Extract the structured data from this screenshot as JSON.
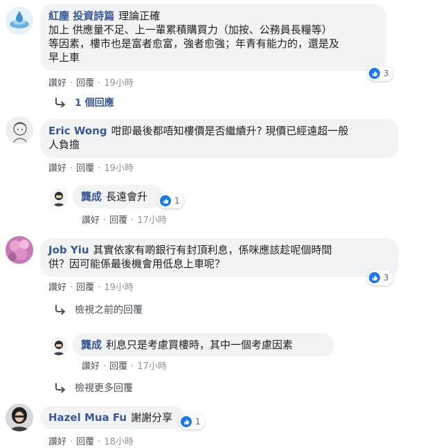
{
  "comments": [
    {
      "author": "紅塵 投資詩篇",
      "lines": [
        "理論正確",
        "加上 供應量不足、上一輩累積購買力（加按、公務員長糧等）",
        "等因素，樓市也是富者愈富，強者愈強；年青有能力的，還是及",
        "早上車"
      ],
      "actions": {
        "like": "讚好",
        "reply": "回覆",
        "time": "19小時"
      },
      "reactions": "3",
      "replies_link": "1 個回應"
    },
    {
      "author": "Eric Wong",
      "lines": [
        "咁即最後都唔知樓價是否繼續升? 現價已經遠超一般",
        "人負擔"
      ],
      "actions": {
        "like": "讚好",
        "reply": "回覆",
        "time": "19小時"
      }
    },
    {
      "author": "Job Yiu",
      "lines": [
        "其實依家有啲銀行有封頂利息，係咪應該趁呢個時間",
        "供？因可能係最後機會用低息上車呢？"
      ],
      "actions": {
        "like": "讚好",
        "reply": "回覆",
        "time": "19小時"
      },
      "reactions": "3"
    },
    {
      "author": "Hazel Mua Fu",
      "lines": [
        "謝謝分享"
      ],
      "actions": {
        "like": "讚好",
        "reply": "回覆",
        "time": "18小時"
      },
      "reactions": "1"
    }
  ],
  "replies": [
    {
      "author": "龔成",
      "text": "長遠會升",
      "actions": {
        "like": "讚好",
        "reply": "回覆",
        "time": "17小時"
      },
      "reactions": "1"
    },
    {
      "author": "龔成",
      "text": "利息只是考慮買樓時，其中一個考慮因素",
      "actions": {
        "like": "讚好",
        "reply": "回覆",
        "time": "17小時"
      }
    }
  ],
  "view_previous": "檢視之前的回覆",
  "view_more": "檢視更多回覆",
  "colors": {
    "link": "#385898",
    "bubble": "#f2f3f5",
    "like": "#1877f2"
  }
}
